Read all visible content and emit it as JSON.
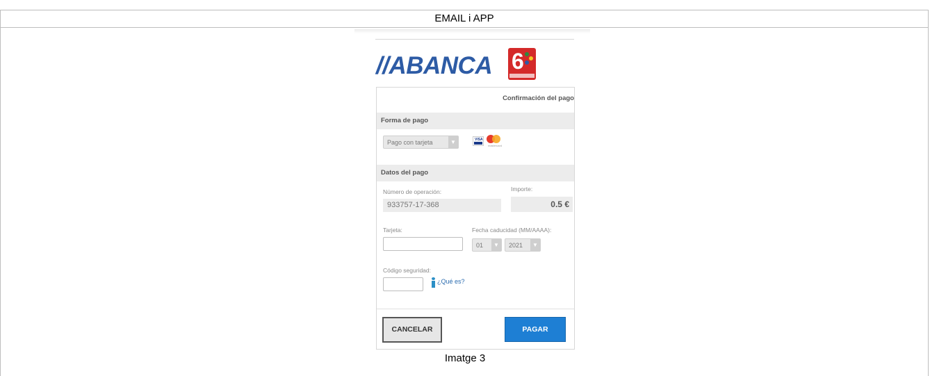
{
  "document": {
    "header": "EMAIL i APP",
    "caption": "Imatge 3"
  },
  "bank": {
    "logo_text": "//ABANCA",
    "lottery_logo_text": "6"
  },
  "payment": {
    "confirm_title": "Confirmación del pago",
    "section_method": "Forma de pago",
    "method_select": "Pago con tarjeta",
    "card_brands": [
      "VISA",
      "mastercard"
    ],
    "section_data": "Datos del pago",
    "operation_label": "Número de operación:",
    "operation_value": "933757-17-368",
    "amount_label": "Importe:",
    "amount_value": "0.5 €",
    "card_label": "Tarjeta:",
    "expiry_label": "Fecha caducidad (MM/AAAA):",
    "expiry_month": "01",
    "expiry_year": "2021",
    "security_label": "Código seguridad:",
    "help_link": "¿Qué es?",
    "cancel_button": "CANCELAR",
    "pay_button": "PAGAR"
  },
  "colors": {
    "brand_blue": "#2d5ba5",
    "pay_button": "#1e7fd4",
    "lottery_red": "#d42a2a"
  }
}
